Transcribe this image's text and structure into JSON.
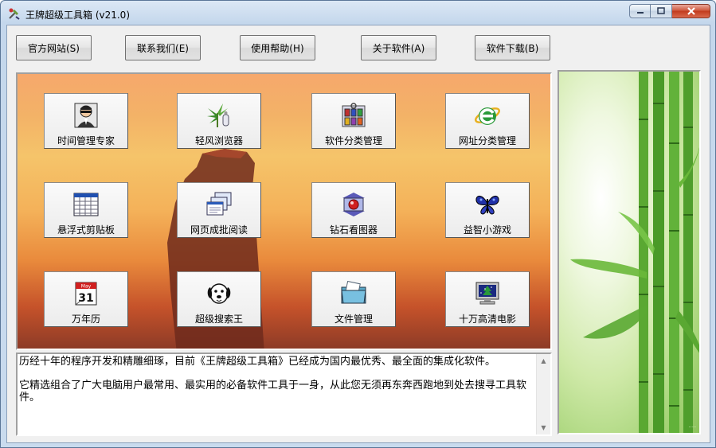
{
  "window": {
    "title": "王牌超级工具箱  (v21.0)"
  },
  "toolbar": {
    "buttons": [
      {
        "label": "官方网站(S)"
      },
      {
        "label": "联系我们(E)"
      },
      {
        "label": "使用帮助(H)"
      },
      {
        "label": "关于软件(A)"
      },
      {
        "label": "软件下载(B)"
      }
    ]
  },
  "tiles": [
    {
      "label": "时间管理专家",
      "icon": "man-sunglasses-icon"
    },
    {
      "label": "轻风浏览器",
      "icon": "plant-browser-icon"
    },
    {
      "label": "软件分类管理",
      "icon": "software-folders-icon"
    },
    {
      "label": "网址分类管理",
      "icon": "ie-e-icon"
    },
    {
      "label": "悬浮式剪贴板",
      "icon": "calendar-grid-icon"
    },
    {
      "label": "网页成批阅读",
      "icon": "stacked-pages-icon"
    },
    {
      "label": "钻石看图器",
      "icon": "diamond-viewer-icon"
    },
    {
      "label": "益智小游戏",
      "icon": "butterfly-icon"
    },
    {
      "label": "万年历",
      "icon": "calendar-31-icon"
    },
    {
      "label": "超级搜索王",
      "icon": "dog-icon"
    },
    {
      "label": "文件管理",
      "icon": "folder-icon"
    },
    {
      "label": "十万高清电影",
      "icon": "monitor-tree-icon"
    }
  ],
  "calendar_day": "31",
  "calendar_month": "May",
  "description": {
    "line1": "历经十年的程序开发和精雕细琢，目前《王牌超级工具箱》已经成为国内最优秀、最全面的集成化软件。",
    "line2": "它精选组合了广大电脑用户最常用、最实用的必备软件工具于一身，从此您无须再东奔西跑地到处去搜寻工具软件。"
  },
  "colors": {
    "accent": "#2f6fb7",
    "panel_sky": "#f3b267",
    "bamboo": "#6fb23b"
  }
}
